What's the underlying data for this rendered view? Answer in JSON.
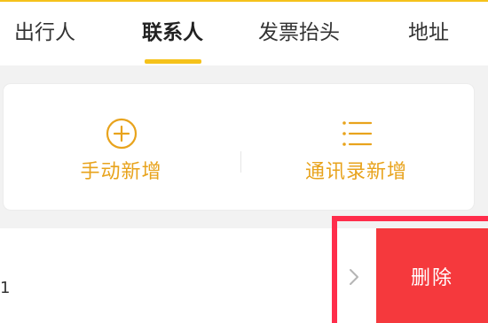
{
  "tabs": [
    {
      "label": "出行人"
    },
    {
      "label": "联系人"
    },
    {
      "label": "发票抬头"
    },
    {
      "label": "地址"
    }
  ],
  "active_tab": "联系人",
  "card": {
    "manual_add_label": "手动新增",
    "contacts_add_label": "通讯录新增"
  },
  "row": {
    "partial_text": "1",
    "delete_label": "删除"
  },
  "icons": {
    "manual_add": "plus-circle-icon",
    "contacts_add": "list-icon",
    "chevron": "chevron-right-icon"
  },
  "colors": {
    "accent": "#f5c21b",
    "action_text": "#e8a31c",
    "delete_bg": "#f5393d",
    "highlight": "#ff2d4b"
  }
}
